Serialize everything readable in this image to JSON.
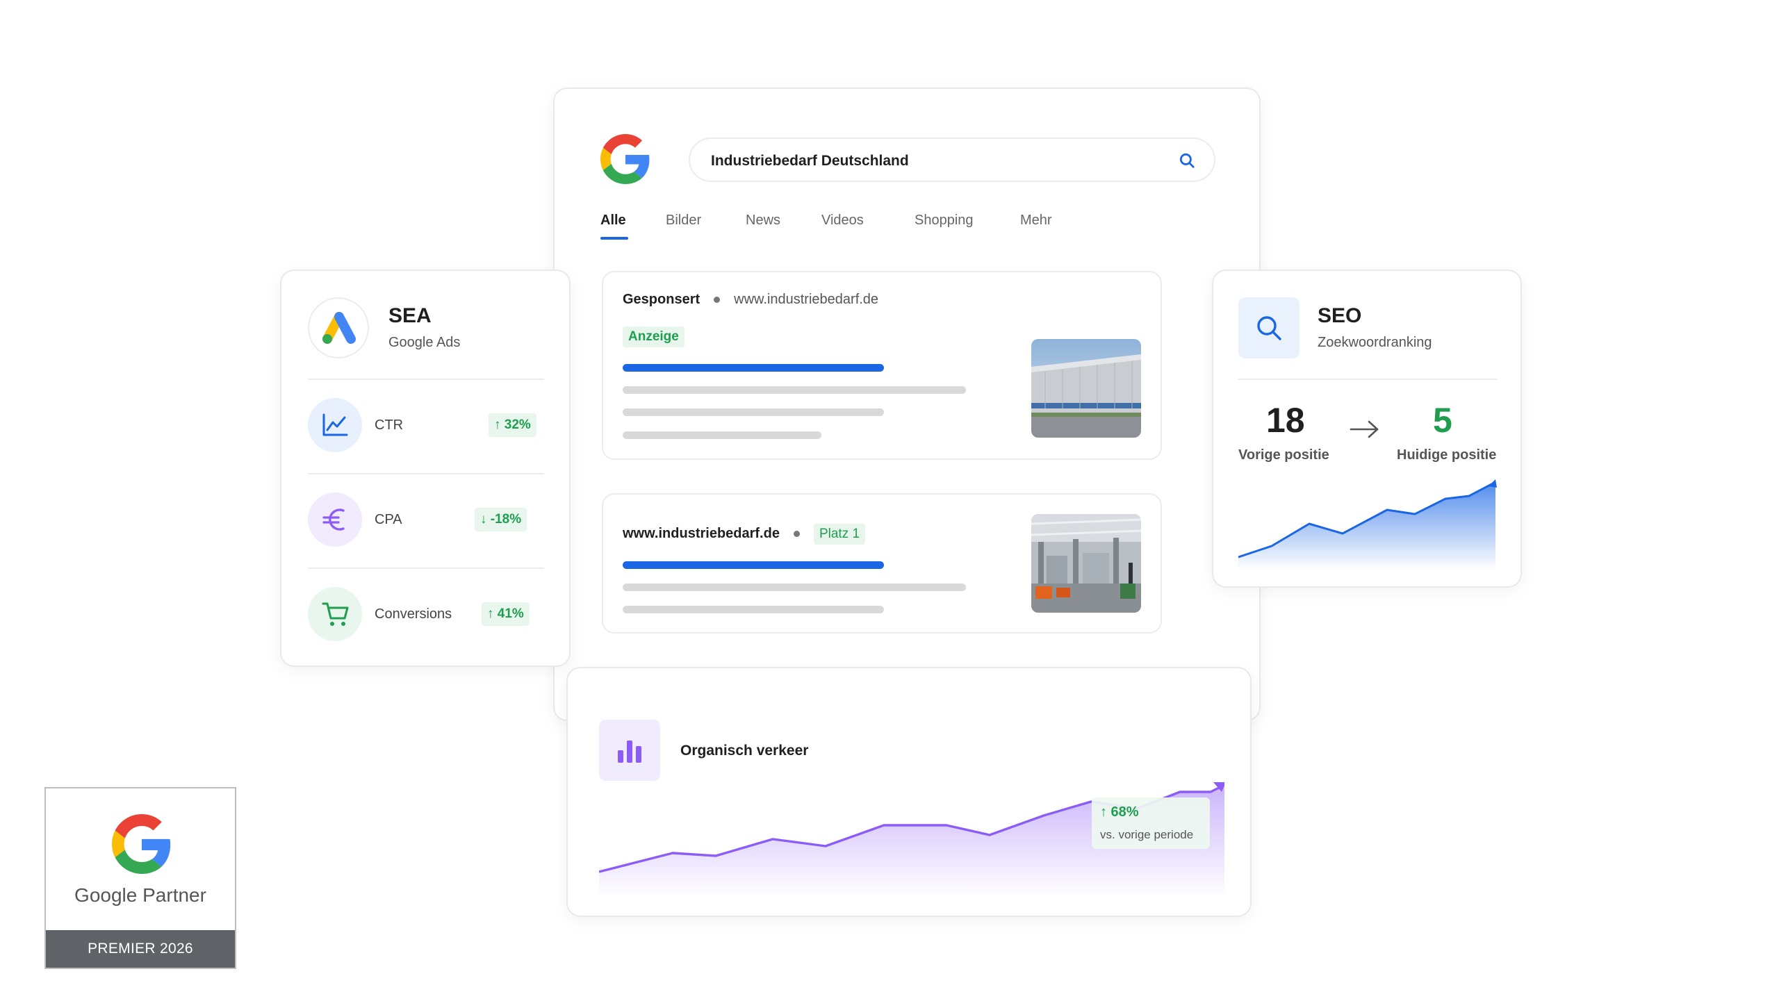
{
  "search": {
    "query": "Industriebedarf Deutschland",
    "tabs": [
      "Alle",
      "Bilder",
      "News",
      "Videos",
      "Shopping",
      "Mehr"
    ],
    "ad_result": {
      "label": "Gesponsert",
      "url": "www.industriebedarf.de",
      "badge": "Anzeige"
    },
    "organic_result": {
      "url": "www.industriebedarf.de",
      "badge": "Platz 1"
    }
  },
  "sea": {
    "title": "SEA",
    "subtitle": "Google Ads",
    "metrics": [
      {
        "label": "CTR",
        "value": "↑ 32%",
        "icon": "line-chart-icon"
      },
      {
        "label": "CPA",
        "value": "↓ -18%",
        "icon": "euro-icon"
      },
      {
        "label": "Conversions",
        "value": "↑ 41%",
        "icon": "cart-icon"
      }
    ]
  },
  "seo": {
    "title": "SEO",
    "subtitle": "Zoekwoordranking",
    "previous_rank": "18",
    "previous_label": "Vorige positie",
    "current_rank": "5",
    "current_label": "Huidige positie"
  },
  "organic": {
    "title": "Organisch verkeer",
    "change": "↑ 68%",
    "change_label": "vs. vorige periode"
  },
  "partner": {
    "name": "Google Partner",
    "tier": "PREMIER 2026"
  },
  "colors": {
    "google_blue": "#1a66e5",
    "success_green": "#1e9e4e",
    "organic_purple": "#8b5cf6",
    "badge_footer": "#5f6368"
  }
}
